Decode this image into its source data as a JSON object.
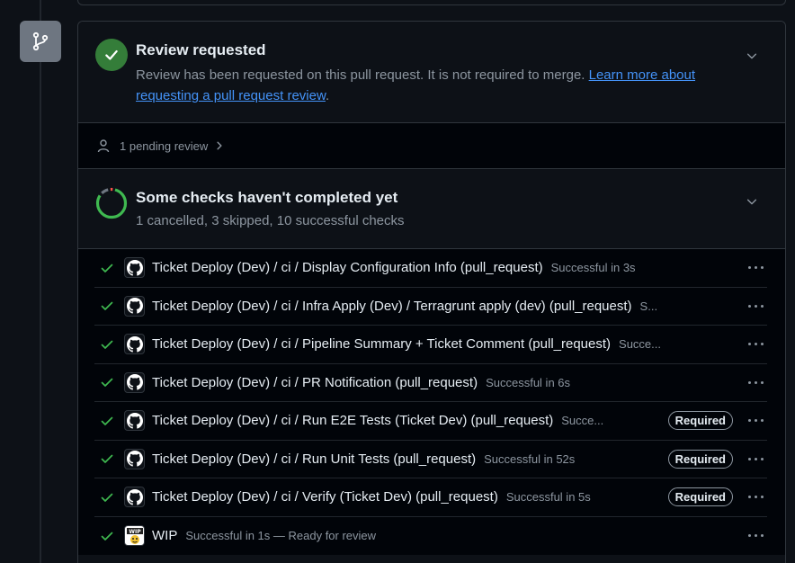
{
  "review": {
    "title": "Review requested",
    "description": "Review has been requested on this pull request. It is not required to merge. ",
    "link": "Learn more about requesting a pull request review",
    "link_suffix": "."
  },
  "pending": {
    "label": "1 pending review"
  },
  "checks": {
    "title": "Some checks haven't completed yet",
    "summary": "1 cancelled, 3 skipped, 10 successful checks",
    "progress_segments": {
      "successful": 10,
      "cancelled": 1,
      "skipped": 3
    },
    "items": [
      {
        "name": "Ticket Deploy (Dev) / ci / Display Configuration Info (pull_request)",
        "status": "Successful in 3s",
        "required": "",
        "icon": "github-icon"
      },
      {
        "name": "Ticket Deploy (Dev) / ci / Infra Apply (Dev) / Terragrunt apply (dev) (pull_request)",
        "status": "S...",
        "required": "",
        "icon": "github-icon"
      },
      {
        "name": "Ticket Deploy (Dev) / ci / Pipeline Summary + Ticket Comment (pull_request)",
        "status": "Succe...",
        "required": "",
        "icon": "github-icon"
      },
      {
        "name": "Ticket Deploy (Dev) / ci / PR Notification (pull_request)",
        "status": "Successful in 6s",
        "required": "",
        "icon": "github-icon"
      },
      {
        "name": "Ticket Deploy (Dev) / ci / Run E2E Tests (Ticket Dev) (pull_request)",
        "status": "Succe...",
        "required": "Required",
        "icon": "github-icon"
      },
      {
        "name": "Ticket Deploy (Dev) / ci / Run Unit Tests (pull_request)",
        "status": "Successful in 52s",
        "required": "Required",
        "icon": "github-icon"
      },
      {
        "name": "Ticket Deploy (Dev) / ci / Verify (Ticket Dev) (pull_request)",
        "status": "Successful in 5s",
        "required": "Required",
        "icon": "github-icon"
      },
      {
        "name": "WIP",
        "status": "Successful in 1s — Ready for review",
        "required": "",
        "icon": "wip-app-icon"
      }
    ]
  },
  "colors": {
    "success": "#3fb950",
    "badge_green": "#347d39",
    "cancelled": "#f85149",
    "link": "#4493f8"
  }
}
